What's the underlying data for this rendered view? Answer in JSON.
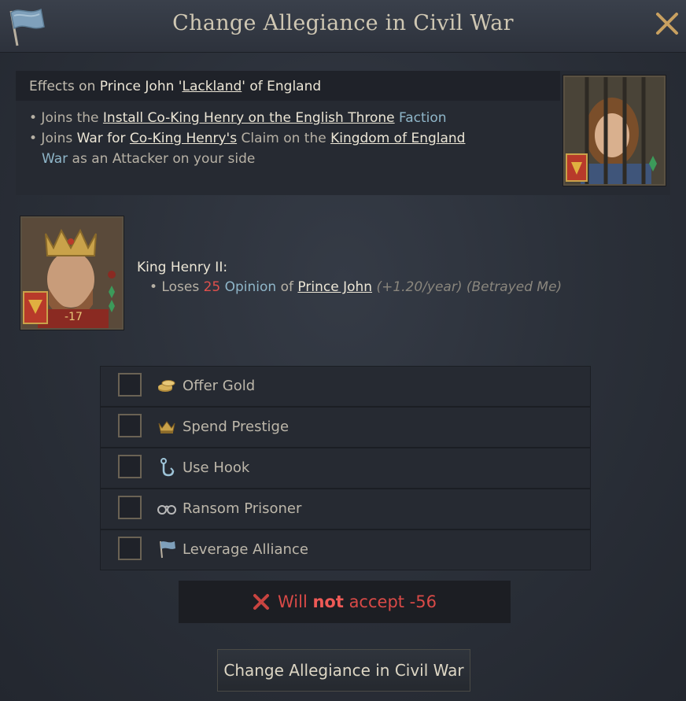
{
  "window": {
    "title": "Change Allegiance in Civil War",
    "flag_icon": "blue-banner-icon",
    "close_icon": "close-icon"
  },
  "effects": {
    "prefix": "Effects on ",
    "name_part1": "Prince John '",
    "nickname": "Lackland",
    "name_part2": "' of England",
    "bullet1": {
      "prefix": "• Joins the ",
      "link": "Install Co-King Henry on the English Throne",
      "suffix": " Faction"
    },
    "bullet2": {
      "prefix": "• Joins ",
      "war": "War for ",
      "link1": "Co-King Henry's",
      "mid": " Claim on the ",
      "link2": "Kingdom of England",
      "line2_war": "War",
      "line2_rest": " as an Attacker on your side"
    }
  },
  "henry": {
    "name": "King Henry II:",
    "bullet": "• Loses ",
    "amount": "25",
    "opinion": " Opinion",
    "of": " of ",
    "target": "Prince John",
    "note": " (+1.20/year) (Betrayed Me)",
    "portrait_badge": "-17"
  },
  "options": [
    {
      "label": "Offer Gold",
      "icon": "gold-coins-icon",
      "checked": false
    },
    {
      "label": "Spend Prestige",
      "icon": "crown-icon",
      "checked": false
    },
    {
      "label": "Use Hook",
      "icon": "hook-icon",
      "checked": false
    },
    {
      "label": "Ransom Prisoner",
      "icon": "shackles-icon",
      "checked": false
    },
    {
      "label": "Leverage Alliance",
      "icon": "banner-icon",
      "checked": false
    }
  ],
  "verdict": {
    "pre": "Will ",
    "bold": "not",
    "post": " accept -56",
    "icon": "red-x-icon"
  },
  "action_button": "Change Allegiance in Civil War",
  "colors": {
    "accent_red": "#d94a47",
    "faction_blue": "#8fb6c9",
    "gold": "#c9a24a"
  }
}
